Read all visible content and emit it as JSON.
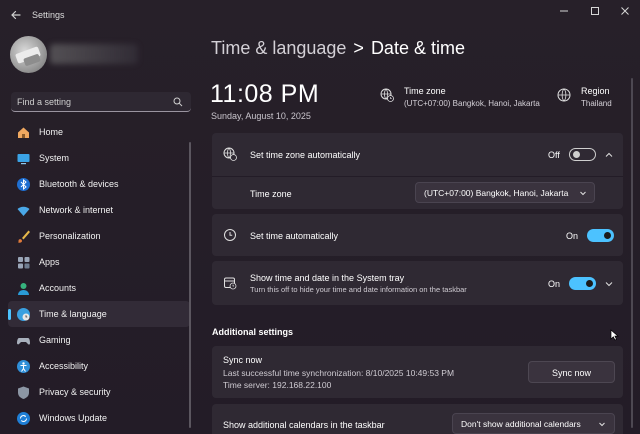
{
  "window": {
    "app_title": "Settings",
    "minimize_glyph": "—",
    "maximize_glyph": "☐",
    "close_glyph": "✕"
  },
  "sidebar": {
    "search_placeholder": "Find a setting",
    "items": [
      {
        "label": "Home",
        "icon": "home-icon"
      },
      {
        "label": "System",
        "icon": "system-icon"
      },
      {
        "label": "Bluetooth & devices",
        "icon": "bluetooth-icon"
      },
      {
        "label": "Network & internet",
        "icon": "wifi-icon"
      },
      {
        "label": "Personalization",
        "icon": "brush-icon"
      },
      {
        "label": "Apps",
        "icon": "apps-icon"
      },
      {
        "label": "Accounts",
        "icon": "accounts-icon"
      },
      {
        "label": "Time & language",
        "icon": "globe-clock-icon",
        "selected": true
      },
      {
        "label": "Gaming",
        "icon": "gamepad-icon"
      },
      {
        "label": "Accessibility",
        "icon": "accessibility-icon"
      },
      {
        "label": "Privacy & security",
        "icon": "shield-icon"
      },
      {
        "label": "Windows Update",
        "icon": "update-icon"
      }
    ]
  },
  "header": {
    "parent": "Time & language",
    "separator": ">",
    "current": "Date & time"
  },
  "clock": {
    "time": "11:08 PM",
    "date": "Sunday, August 10, 2025"
  },
  "timezone_info": {
    "title": "Time zone",
    "value": "(UTC+07:00) Bangkok, Hanoi, Jakarta"
  },
  "region_info": {
    "title": "Region",
    "value": "Thailand"
  },
  "settings": {
    "auto_timezone": {
      "label": "Set time zone automatically",
      "state": "Off"
    },
    "timezone": {
      "label": "Time zone",
      "value": "(UTC+07:00) Bangkok, Hanoi, Jakarta"
    },
    "auto_time": {
      "label": "Set time automatically",
      "state": "On"
    },
    "systray": {
      "label": "Show time and date in the System tray",
      "sub": "Turn this off to hide your time and date information on the taskbar",
      "state": "On"
    }
  },
  "additional": {
    "title": "Additional settings",
    "sync": {
      "label": "Sync now",
      "last_sync": "Last successful time synchronization: 8/10/2025 10:49:53 PM",
      "server": "Time server: 192.168.22.100",
      "button": "Sync now"
    },
    "calendars": {
      "label": "Show additional calendars in the taskbar",
      "value": "Don't show additional calendars"
    }
  },
  "colors": {
    "accent": "#4cc2ff",
    "background": "#231c27",
    "card": "#2f2933"
  }
}
